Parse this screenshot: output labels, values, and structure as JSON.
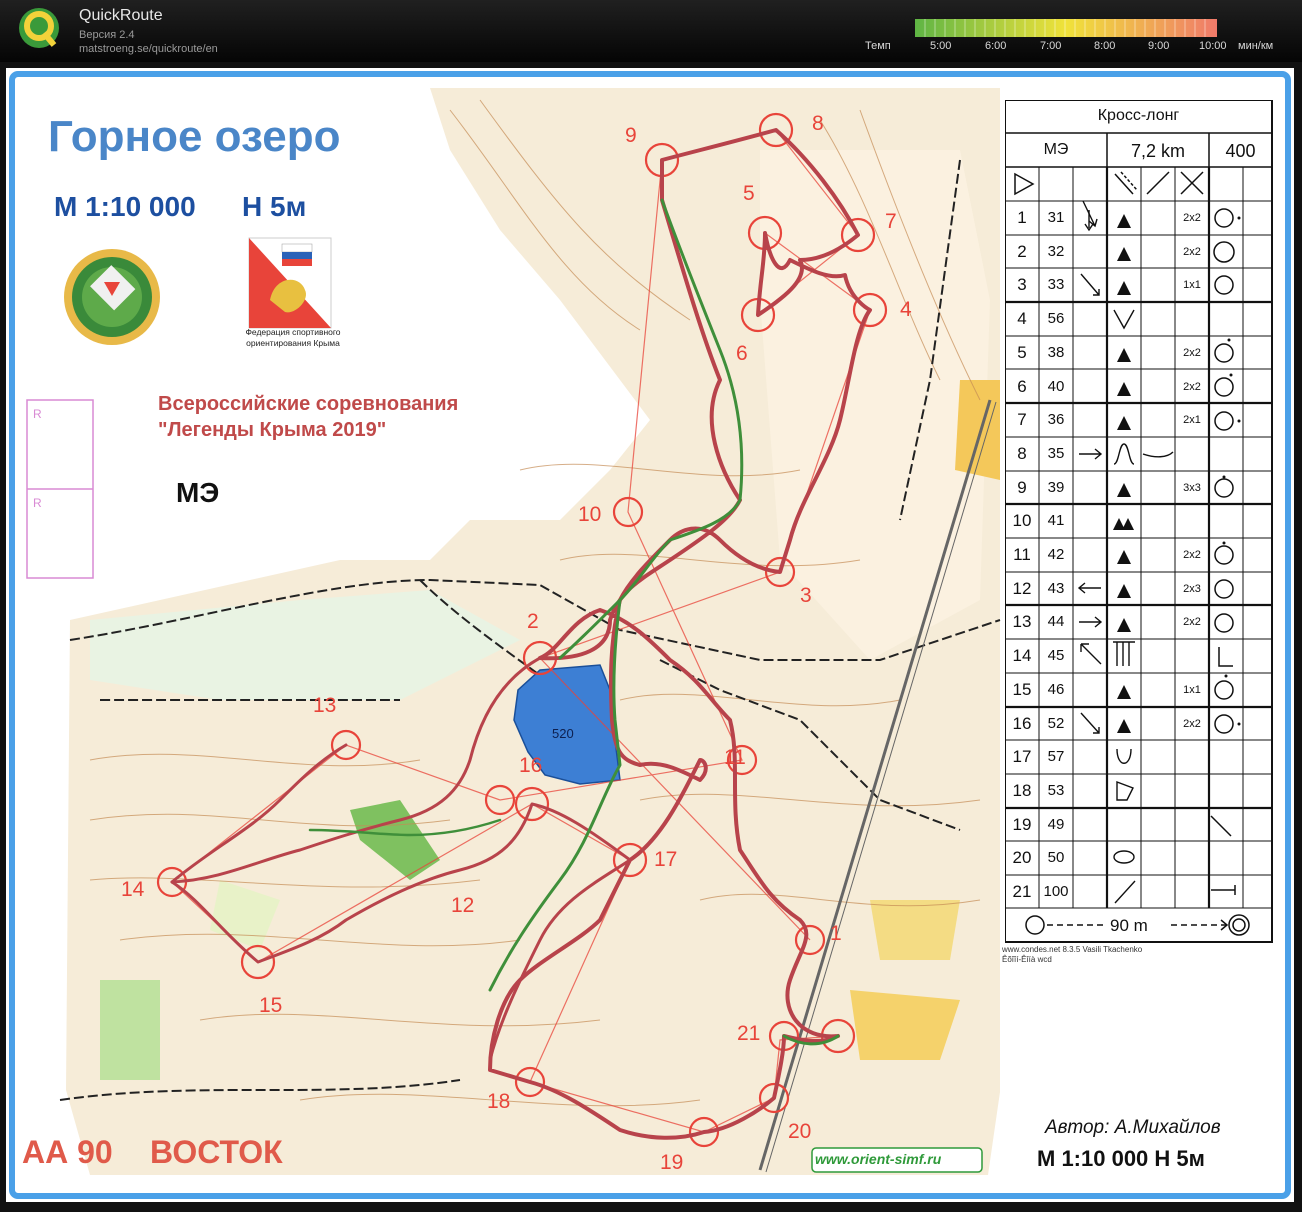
{
  "header": {
    "app_title": "QuickRoute",
    "app_version": "Версия 2.4",
    "app_url": "matstroeng.se/quickroute/en",
    "pace_label": "Темп",
    "pace_ticks": [
      "5:00",
      "6:00",
      "7:00",
      "8:00",
      "9:00",
      "10:00"
    ],
    "pace_unit": "мин/км",
    "pace_colors": [
      "#5fb544",
      "#f0e23a",
      "#f07a6a"
    ]
  },
  "map": {
    "title": "Горное озеро",
    "scale": "М 1:10 000",
    "contour": "Н 5м",
    "federation": "Федерация спортивного ориентирования Крыма",
    "event_line1": "Всероссийские соревнования",
    "event_line2": "\"Легенды Крыма 2019\"",
    "class_label": "МЭ",
    "zone_label": "АА 90",
    "direction_label": "ВОСТОК",
    "website": "www.orient-simf.ru",
    "author": "Автор: А.Михайлов",
    "bottom_scale": "М 1:10 000  Н 5м",
    "lake_label": "520",
    "route_color": "#b8434b",
    "course_color": "#e8443a",
    "lake_color": "#3d7fd4"
  },
  "legend": {
    "course_name": "Кросс-лонг",
    "class": "МЭ",
    "length": "7,2 km",
    "climb": "400",
    "controls": [
      {
        "num": "1",
        "code": "31",
        "size": "2x2"
      },
      {
        "num": "2",
        "code": "32",
        "size": "2x2"
      },
      {
        "num": "3",
        "code": "33",
        "size": "1x1"
      },
      {
        "num": "4",
        "code": "56",
        "size": ""
      },
      {
        "num": "5",
        "code": "38",
        "size": "2x2"
      },
      {
        "num": "6",
        "code": "40",
        "size": "2x2"
      },
      {
        "num": "7",
        "code": "36",
        "size": "2x1"
      },
      {
        "num": "8",
        "code": "35",
        "size": ""
      },
      {
        "num": "9",
        "code": "39",
        "size": "3x3"
      },
      {
        "num": "10",
        "code": "41",
        "size": ""
      },
      {
        "num": "11",
        "code": "42",
        "size": "2x2"
      },
      {
        "num": "12",
        "code": "43",
        "size": "2x3"
      },
      {
        "num": "13",
        "code": "44",
        "size": "2x2"
      },
      {
        "num": "14",
        "code": "45",
        "size": ""
      },
      {
        "num": "15",
        "code": "46",
        "size": "1x1"
      },
      {
        "num": "16",
        "code": "52",
        "size": "2x2"
      },
      {
        "num": "17",
        "code": "57",
        "size": ""
      },
      {
        "num": "18",
        "code": "53",
        "size": ""
      },
      {
        "num": "19",
        "code": "49",
        "size": ""
      },
      {
        "num": "20",
        "code": "50",
        "size": ""
      },
      {
        "num": "21",
        "code": "100",
        "size": ""
      }
    ],
    "finish_label": "90 m",
    "credit1": "www.condes.net 8.3.5 Vasili Tkachenko",
    "credit2": "Êõîîí-Êîíà wcd"
  },
  "course_controls": [
    {
      "label": "1"
    },
    {
      "label": "2"
    },
    {
      "label": "3"
    },
    {
      "label": "4"
    },
    {
      "label": "5"
    },
    {
      "label": "6"
    },
    {
      "label": "7"
    },
    {
      "label": "8"
    },
    {
      "label": "9"
    },
    {
      "label": "10"
    },
    {
      "label": "11"
    },
    {
      "label": "12"
    },
    {
      "label": "13"
    },
    {
      "label": "14"
    },
    {
      "label": "15"
    },
    {
      "label": "16"
    },
    {
      "label": "17"
    },
    {
      "label": "18"
    },
    {
      "label": "19"
    },
    {
      "label": "20"
    },
    {
      "label": "21"
    }
  ]
}
